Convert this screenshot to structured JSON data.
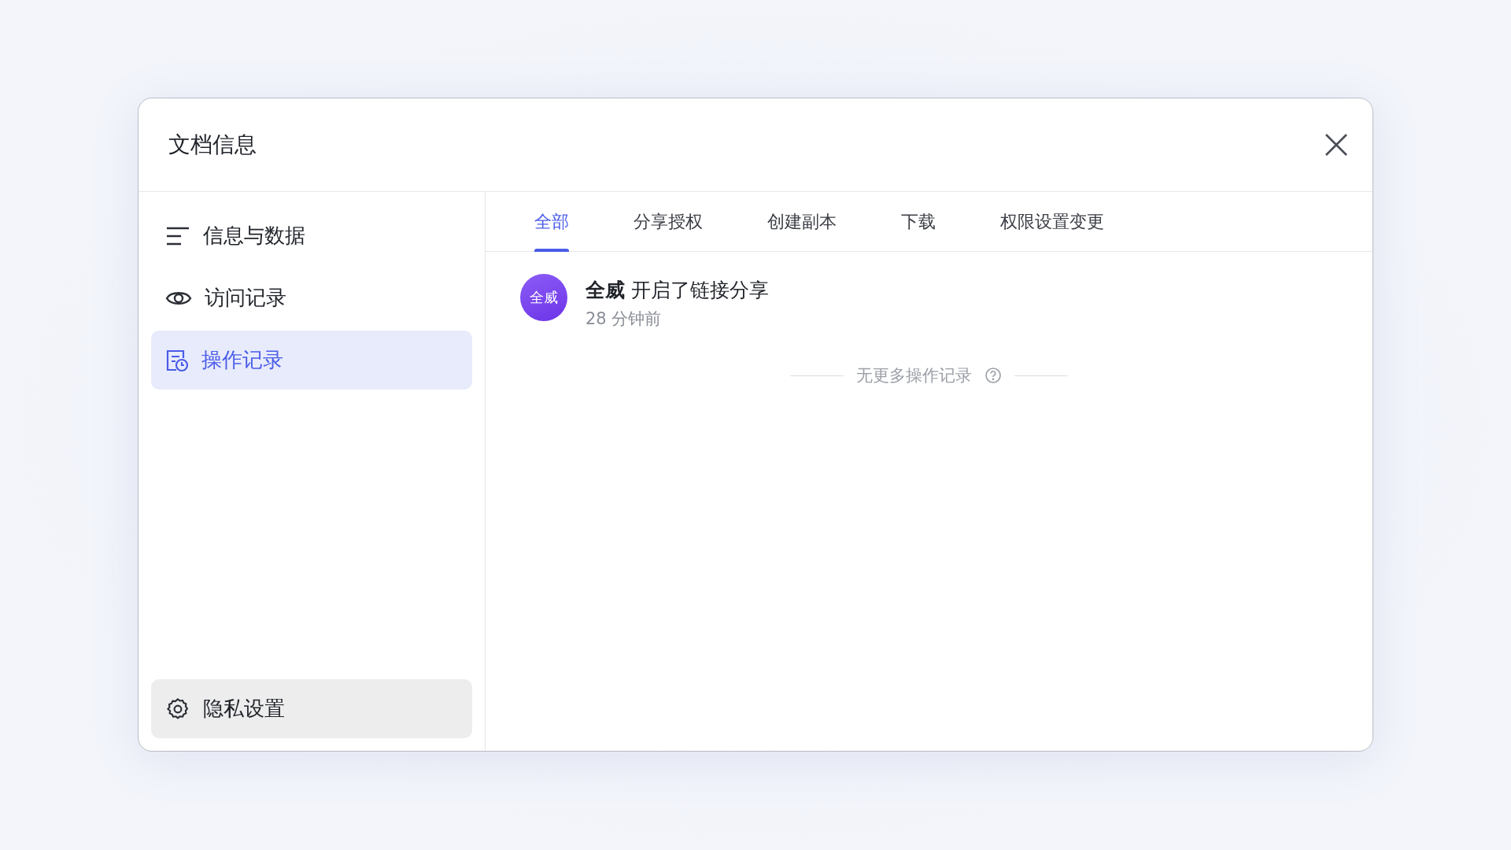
{
  "dialog": {
    "title": "文档信息"
  },
  "sidebar": {
    "items": [
      {
        "label": "信息与数据",
        "kind": "lines",
        "selected": false
      },
      {
        "label": "访问记录",
        "kind": "eye",
        "selected": false
      },
      {
        "label": "操作记录",
        "kind": "log",
        "selected": true
      }
    ],
    "footer_button": {
      "label": "隐私设置"
    }
  },
  "tabs": [
    {
      "label": "全部",
      "selected": true
    },
    {
      "label": "分享授权",
      "selected": false
    },
    {
      "label": "创建副本",
      "selected": false
    },
    {
      "label": "下载",
      "selected": false
    },
    {
      "label": "权限设置变更",
      "selected": false
    }
  ],
  "events": [
    {
      "avatar": "全威",
      "text": "**全威** 开启了链接分享",
      "time": "28 分钟前"
    }
  ],
  "end_note": "无更多操作记录"
}
